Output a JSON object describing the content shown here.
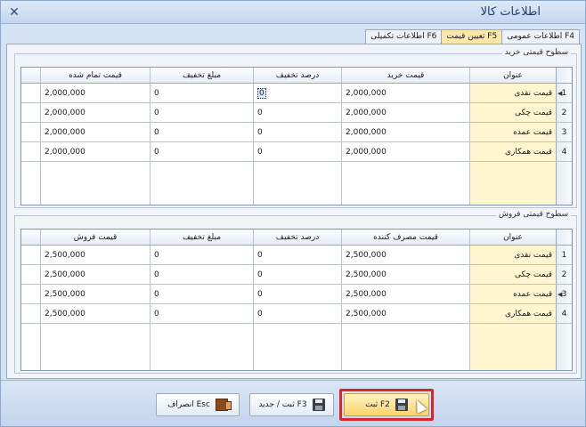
{
  "window": {
    "title": "اطلاعات کالا",
    "close_glyph": "✕"
  },
  "tabs": [
    {
      "label": "اطلاعات عمومی F4",
      "active": false
    },
    {
      "label": "تعیین قیمت F5",
      "active": true
    },
    {
      "label": "اطلاعات تکمیلی F6",
      "active": false
    }
  ],
  "purchase": {
    "group_label": "سطوح قیمتی خرید",
    "headers": [
      "عنوان",
      "قیمت خرید",
      "درصد تخفیف",
      "مبلغ تخفیف",
      "قیمت تمام شده"
    ],
    "rows": [
      {
        "index": "1",
        "title": "قیمت نقدی",
        "price": "2,000,000",
        "discount_pct": "0",
        "discount_amount": "0",
        "total": "2,000,000",
        "current": true
      },
      {
        "index": "2",
        "title": "قیمت چکی",
        "price": "2,000,000",
        "discount_pct": "0",
        "discount_amount": "0",
        "total": "2,000,000",
        "current": false
      },
      {
        "index": "3",
        "title": "قیمت عمده",
        "price": "2,000,000",
        "discount_pct": "0",
        "discount_amount": "0",
        "total": "2,000,000",
        "current": false
      },
      {
        "index": "4",
        "title": "قیمت همکاری",
        "price": "2,000,000",
        "discount_pct": "0",
        "discount_amount": "0",
        "total": "2,000,000",
        "current": false
      }
    ]
  },
  "sales": {
    "group_label": "سطوح قیمتی فروش",
    "headers": [
      "عنوان",
      "قیمت مصرف کننده",
      "درصد تخفیف",
      "مبلغ تخفیف",
      "قیمت فروش"
    ],
    "rows": [
      {
        "index": "1",
        "title": "قیمت نقدی",
        "price": "2,500,000",
        "discount_pct": "0",
        "discount_amount": "0",
        "total": "2,500,000",
        "current": false
      },
      {
        "index": "2",
        "title": "قیمت چکی",
        "price": "2,500,000",
        "discount_pct": "0",
        "discount_amount": "0",
        "total": "2,500,000",
        "current": false
      },
      {
        "index": "3",
        "title": "قیمت عمده",
        "price": "2,500,000",
        "discount_pct": "0",
        "discount_amount": "0",
        "total": "2,500,000",
        "current": true
      },
      {
        "index": "4",
        "title": "قیمت همکاری",
        "price": "2,500,000",
        "discount_pct": "0",
        "discount_amount": "0",
        "total": "2,500,000",
        "current": false
      }
    ]
  },
  "buttons": {
    "cancel": "انصراف Esc",
    "save_new": "ثبت / جدید F3",
    "save": "ثبت F2"
  },
  "icons": {
    "cancel": "exit-door-icon",
    "save_new": "save-disk-icon",
    "save": "save-disk-icon"
  },
  "colors": {
    "active_tab": "#fbe7a8",
    "title_column": "#fff6cf",
    "highlight_frame": "#d9262b",
    "primary_button": "#fbd46b"
  }
}
